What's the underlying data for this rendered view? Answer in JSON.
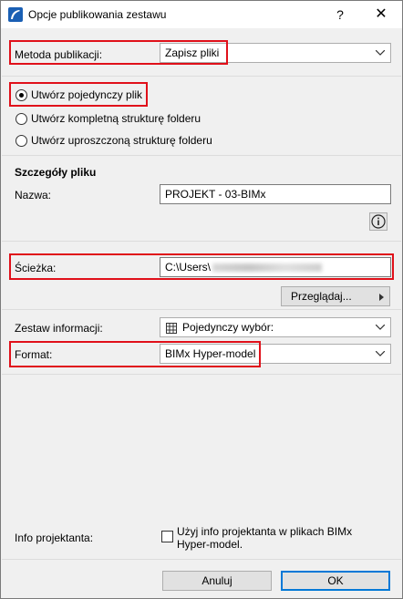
{
  "window": {
    "title": "Opcje publikowania zestawu",
    "help_glyph": "?",
    "close_glyph": "✕"
  },
  "publish_method": {
    "label": "Metoda publikacji:",
    "value": "Zapisz pliki"
  },
  "structure_options": {
    "selected_index": 0,
    "items": [
      {
        "label": "Utwórz pojedynczy plik"
      },
      {
        "label": "Utwórz kompletną strukturę folderu"
      },
      {
        "label": "Utwórz uproszczoną strukturę folderu"
      }
    ]
  },
  "file_details": {
    "section_title": "Szczegóły pliku",
    "name_label": "Nazwa:",
    "name_value": "PROJEKT - 03-BIMx",
    "path_label": "Ścieżka:",
    "path_value": "C:\\Users\\",
    "browse_label": "Przeglądaj..."
  },
  "info_set": {
    "label": "Zestaw informacji:",
    "value": "Pojedynczy wybór:"
  },
  "format": {
    "label": "Format:",
    "value": "BIMx Hyper-model"
  },
  "designer_info": {
    "label": "Info projektanta:",
    "checkbox_text_line1": "Użyj info projektanta w plikach BIMx",
    "checkbox_text_line2": "Hyper-model.",
    "checked": false
  },
  "footer": {
    "cancel_label": "Anuluj",
    "ok_label": "OK"
  },
  "colors": {
    "highlight": "#e0101a",
    "accent": "#0078d7"
  }
}
